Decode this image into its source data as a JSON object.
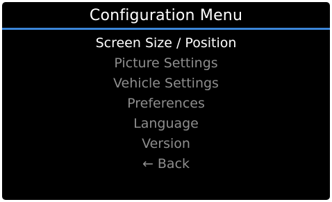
{
  "header": {
    "title": "Configuration Menu"
  },
  "menu": {
    "items": [
      {
        "label": "Screen Size / Position",
        "selected": true
      },
      {
        "label": "Picture Settings",
        "selected": false
      },
      {
        "label": "Vehicle Settings",
        "selected": false
      },
      {
        "label": "Preferences",
        "selected": false
      },
      {
        "label": "Language",
        "selected": false
      },
      {
        "label": "Version",
        "selected": false
      },
      {
        "label": "Back",
        "selected": false,
        "icon": "left-arrow-icon"
      }
    ]
  },
  "colors": {
    "background": "#000000",
    "title_text": "#ffffff",
    "title_rule": "#3b86d8",
    "selected_text": "#ffffff",
    "unselected_text": "#8e8e8e"
  }
}
